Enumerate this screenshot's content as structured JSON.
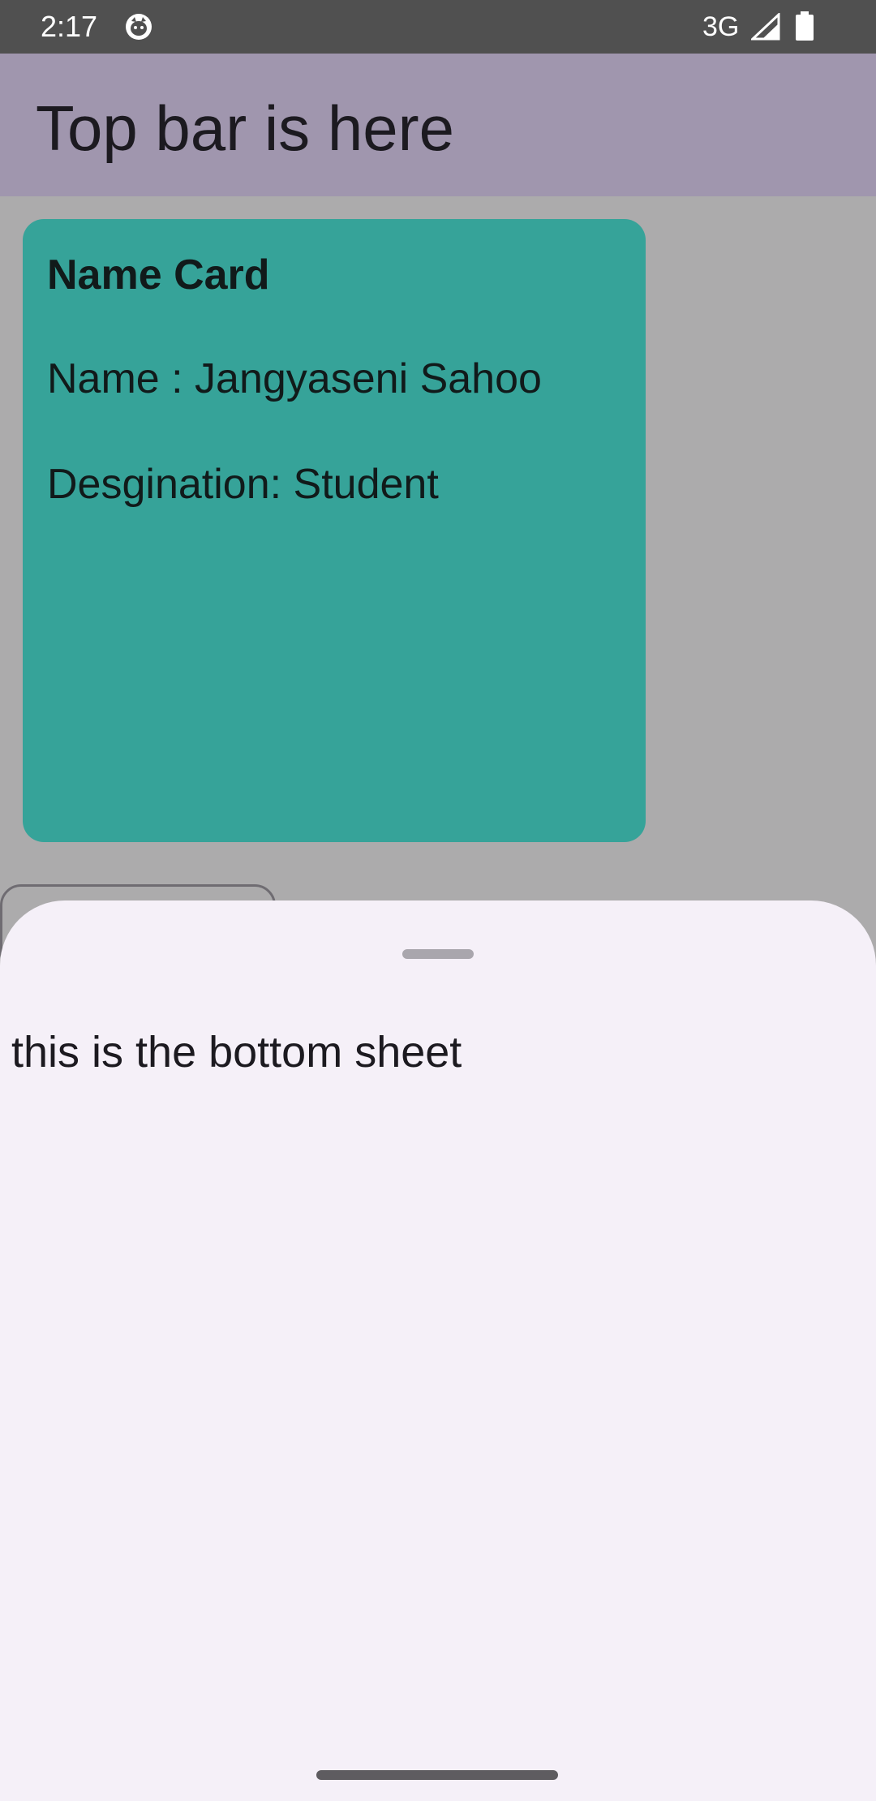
{
  "status_bar": {
    "time": "2:17",
    "network": "3G",
    "icons": [
      "cat-notification-icon",
      "cell-signal-icon",
      "battery-icon"
    ]
  },
  "top_app_bar": {
    "title": "Top bar is here"
  },
  "name_card": {
    "title": "Name Card",
    "name_line": "Name : Jangyaseni Sahoo",
    "designation_line": "Desgination: Student"
  },
  "bottom_sheet": {
    "text": "this is the bottom sheet"
  },
  "colors": {
    "status_bar": "#505050",
    "top_app_bar_dimmed": "#a096ae",
    "content_scrim": "#acabac",
    "card_dimmed": "#36a399",
    "sheet_background": "#f5f0f8",
    "drag_handle": "#a9a6ad",
    "gesture_bar": "#5e5c60"
  }
}
